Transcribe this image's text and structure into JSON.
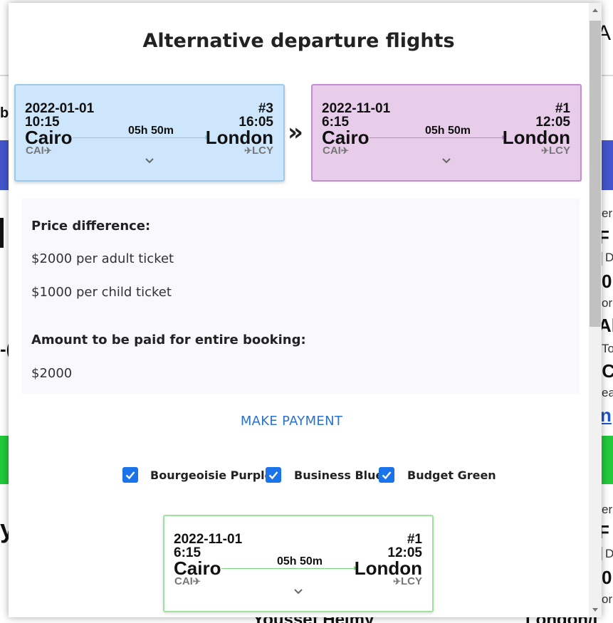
{
  "background": {
    "fragments": {
      "top_right": "A",
      "left_b": "b",
      "right_er1": "er",
      "right_f1": "F l",
      "right_d1": "D",
      "right_0_1": "0",
      "right_or": "or",
      "right_al": "Al",
      "right_to": "To",
      "right_c": ".C",
      "right_ea": "ea",
      "right_link": "n",
      "right_er2": "er",
      "right_f2": "F l",
      "right_d2": "D",
      "right_0_2": "0",
      "right_or2": "or",
      "bottom_mid": "Youssef Helmy",
      "bottom_right": "London/L",
      "left_y": "y",
      "left_dash": "-("
    }
  },
  "modal": {
    "title": "Alternative departure flights",
    "current_flight": {
      "date": "2022-01-01",
      "departure_time": "10:15",
      "flight_number": "#3",
      "arrival_time": "16:05",
      "from_city": "Cairo",
      "to_city": "London",
      "duration": "05h 50m",
      "from_code": "CAI",
      "to_code": "LCY"
    },
    "selected_flight": {
      "date": "2022-11-01",
      "departure_time": "6:15",
      "flight_number": "#1",
      "arrival_time": "12:05",
      "from_city": "Cairo",
      "to_city": "London",
      "duration": "05h 50m",
      "from_code": "CAI",
      "to_code": "LCY"
    },
    "price": {
      "difference_label": "Price difference:",
      "adult": "$2000 per adult ticket",
      "child": "$1000 per child ticket",
      "total_label": "Amount to be paid for entire booking:",
      "total": "$2000"
    },
    "make_payment": "MAKE PAYMENT",
    "filters": [
      {
        "label": "Bourgeoisie Purple",
        "checked": true
      },
      {
        "label": "Business Blue",
        "checked": true
      },
      {
        "label": "Budget Green",
        "checked": true
      }
    ],
    "result_flight": {
      "date": "2022-11-01",
      "departure_time": "6:15",
      "flight_number": "#1",
      "arrival_time": "12:05",
      "from_city": "Cairo",
      "to_city": "London",
      "duration": "05h 50m",
      "from_code": "CAI",
      "to_code": "LCY"
    }
  },
  "colors": {
    "blue_card": "#cde6fb",
    "purple_card": "#e7cde9",
    "green_border": "#9ee39b",
    "checkbox": "#1a73e8",
    "link": "#2a72c9"
  }
}
